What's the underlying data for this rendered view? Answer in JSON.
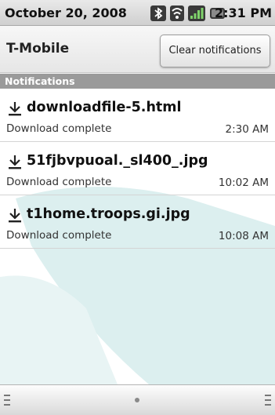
{
  "status_bar": {
    "date": "October 20, 2008",
    "time": "2:31 PM",
    "icons": [
      "bluetooth-icon",
      "wifi-icon",
      "signal-icon",
      "battery-icon"
    ]
  },
  "header": {
    "carrier": "T-Mobile",
    "clear_button_label": "Clear notifications"
  },
  "section": {
    "title": "Notifications"
  },
  "notifications": [
    {
      "title": "downloadfile-5.html",
      "status": "Download complete",
      "time": "2:30 AM",
      "icon": "download-icon"
    },
    {
      "title": "51fjbvpuoal._sl400_.jpg",
      "status": "Download complete",
      "time": "10:02 AM",
      "icon": "download-icon"
    },
    {
      "title": "t1home.troops.gi.jpg",
      "status": "Download complete",
      "time": "10:08 AM",
      "icon": "download-icon"
    }
  ],
  "colors": {
    "background_accent": "#dcefef",
    "section_header": "#9a9a9a"
  }
}
